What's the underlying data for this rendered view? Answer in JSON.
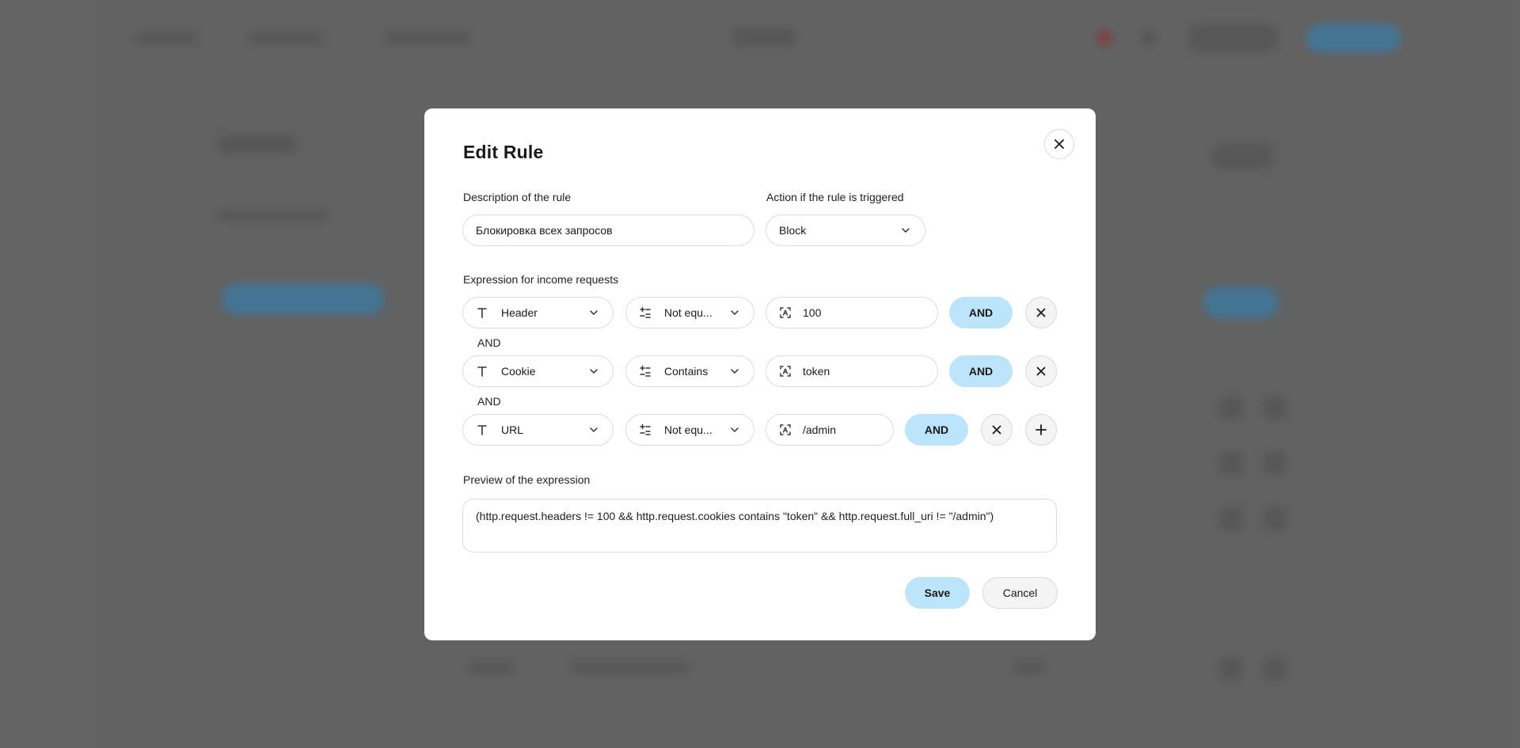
{
  "modal": {
    "title": "Edit Rule",
    "description_label": "Description of the rule",
    "description_value": "Блокировка всех запросов",
    "action_label": "Action if the rule is triggered",
    "action_value": "Block",
    "expression_label": "Expression for income requests",
    "rows": [
      {
        "field": "Header",
        "operator": "Not equ...",
        "value": "100",
        "join": "AND"
      },
      {
        "field": "Cookie",
        "operator": "Contains",
        "value": "token",
        "join": "AND"
      },
      {
        "field": "URL",
        "operator": "Not equ...",
        "value": "/admin",
        "join": "AND"
      }
    ],
    "connectors": [
      "AND",
      "AND"
    ],
    "preview_label": "Preview of the expression",
    "preview_text": "(http.request.headers != 100 && http.request.cookies contains \"token\" && http.request.full_uri != \"/admin\")",
    "save_label": "Save",
    "cancel_label": "Cancel"
  },
  "icons": {
    "close": "close-icon",
    "chevron": "chevron-down-icon",
    "field_type": "text-type-icon",
    "operator": "operator-icon",
    "value": "value-icon",
    "remove": "remove-icon",
    "add": "plus-icon"
  },
  "colors": {
    "accent": "#bce4fb",
    "backdrop": "#6b6b6b",
    "modal_bg": "#ffffff"
  }
}
